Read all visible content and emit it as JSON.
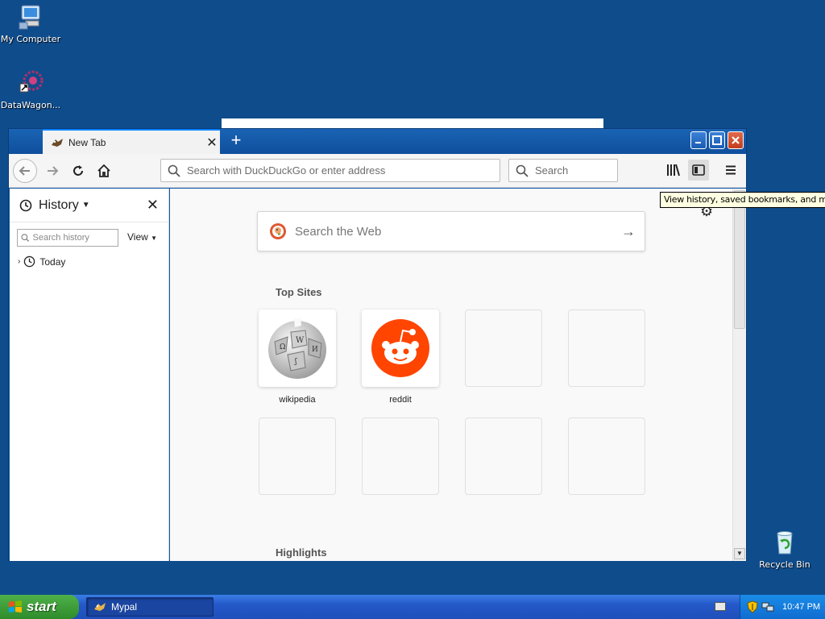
{
  "desktop": {
    "icons": [
      {
        "label": "My Computer"
      },
      {
        "label": "DataWagon..."
      },
      {
        "label": "Recycle Bin"
      }
    ]
  },
  "browser": {
    "tab": {
      "title": "New Tab"
    },
    "urlbar": {
      "placeholder": "Search with DuckDuckGo or enter address"
    },
    "searchbar": {
      "placeholder": "Search"
    },
    "tooltip": "View history, saved bookmarks, and more"
  },
  "sidebar": {
    "title": "History",
    "search_placeholder": "Search history",
    "view_label": "View",
    "items": [
      {
        "label": "Today"
      }
    ]
  },
  "newtab": {
    "search_placeholder": "Search the Web",
    "top_sites_title": "Top Sites",
    "highlights_title": "Highlights",
    "top_sites": [
      {
        "label": "wikipedia"
      },
      {
        "label": "reddit"
      }
    ]
  },
  "taskbar": {
    "start_label": "start",
    "task_label": "Mypal",
    "clock": "10:47 PM"
  },
  "colors": {
    "desktop": "#0f4c8c",
    "reddit": "#ff4500",
    "duckduckgo": "#de5833",
    "start": "#3a9a36"
  }
}
